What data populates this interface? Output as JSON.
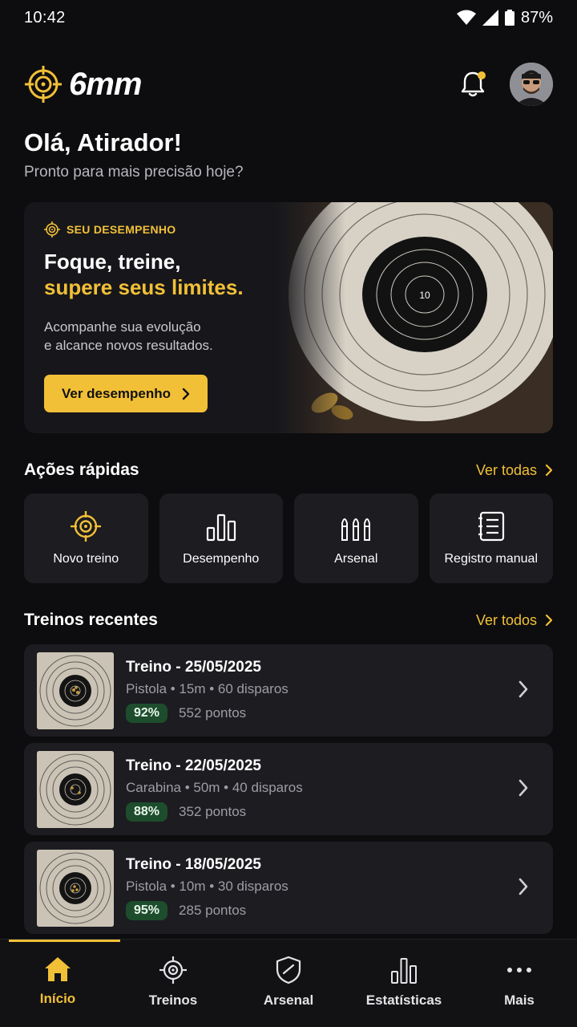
{
  "status": {
    "time": "10:42",
    "battery": "87%"
  },
  "header": {
    "logo_text": "6mm",
    "notification_dot": true
  },
  "greeting": {
    "title": "Olá, Atirador!",
    "subtitle": "Pronto para mais precisão hoje?"
  },
  "hero": {
    "tag": "SEU DESEMPENHO",
    "title_line1": "Foque, treine,",
    "title_line2": "supere seus limites.",
    "desc_line1": "Acompanhe sua evolução",
    "desc_line2": "e alcance novos resultados.",
    "button_label": "Ver desempenho",
    "target_center_label": "10"
  },
  "quick_actions": {
    "title": "Ações rápidas",
    "link": "Ver todas",
    "items": [
      {
        "label": "Novo treino",
        "icon": "target-icon"
      },
      {
        "label": "Desempenho",
        "icon": "bar-chart-icon"
      },
      {
        "label": "Arsenal",
        "icon": "bullets-icon"
      },
      {
        "label": "Registro manual",
        "icon": "notebook-icon"
      }
    ]
  },
  "recent": {
    "title": "Treinos recentes",
    "link": "Ver todos",
    "items": [
      {
        "title": "Treino - 25/05/2025",
        "meta": "Pistola • 15m • 60 disparos",
        "score": "92%",
        "points": "552 pontos"
      },
      {
        "title": "Treino - 22/05/2025",
        "meta": "Carabina • 50m • 40 disparos",
        "score": "88%",
        "points": "352 pontos"
      },
      {
        "title": "Treino - 18/05/2025",
        "meta": "Pistola • 10m • 30 disparos",
        "score": "95%",
        "points": "285 pontos"
      }
    ]
  },
  "tabs": [
    {
      "label": "Início",
      "icon": "home-icon",
      "active": true
    },
    {
      "label": "Treinos",
      "icon": "target-icon",
      "active": false
    },
    {
      "label": "Arsenal",
      "icon": "shield-icon",
      "active": false
    },
    {
      "label": "Estatísticas",
      "icon": "bar-chart-icon",
      "active": false
    },
    {
      "label": "Mais",
      "icon": "more-icon",
      "active": false
    }
  ],
  "colors": {
    "accent": "#f2c037",
    "background": "#0d0d0f",
    "card": "#1c1c21",
    "success_badge": "#1d4d2c"
  }
}
